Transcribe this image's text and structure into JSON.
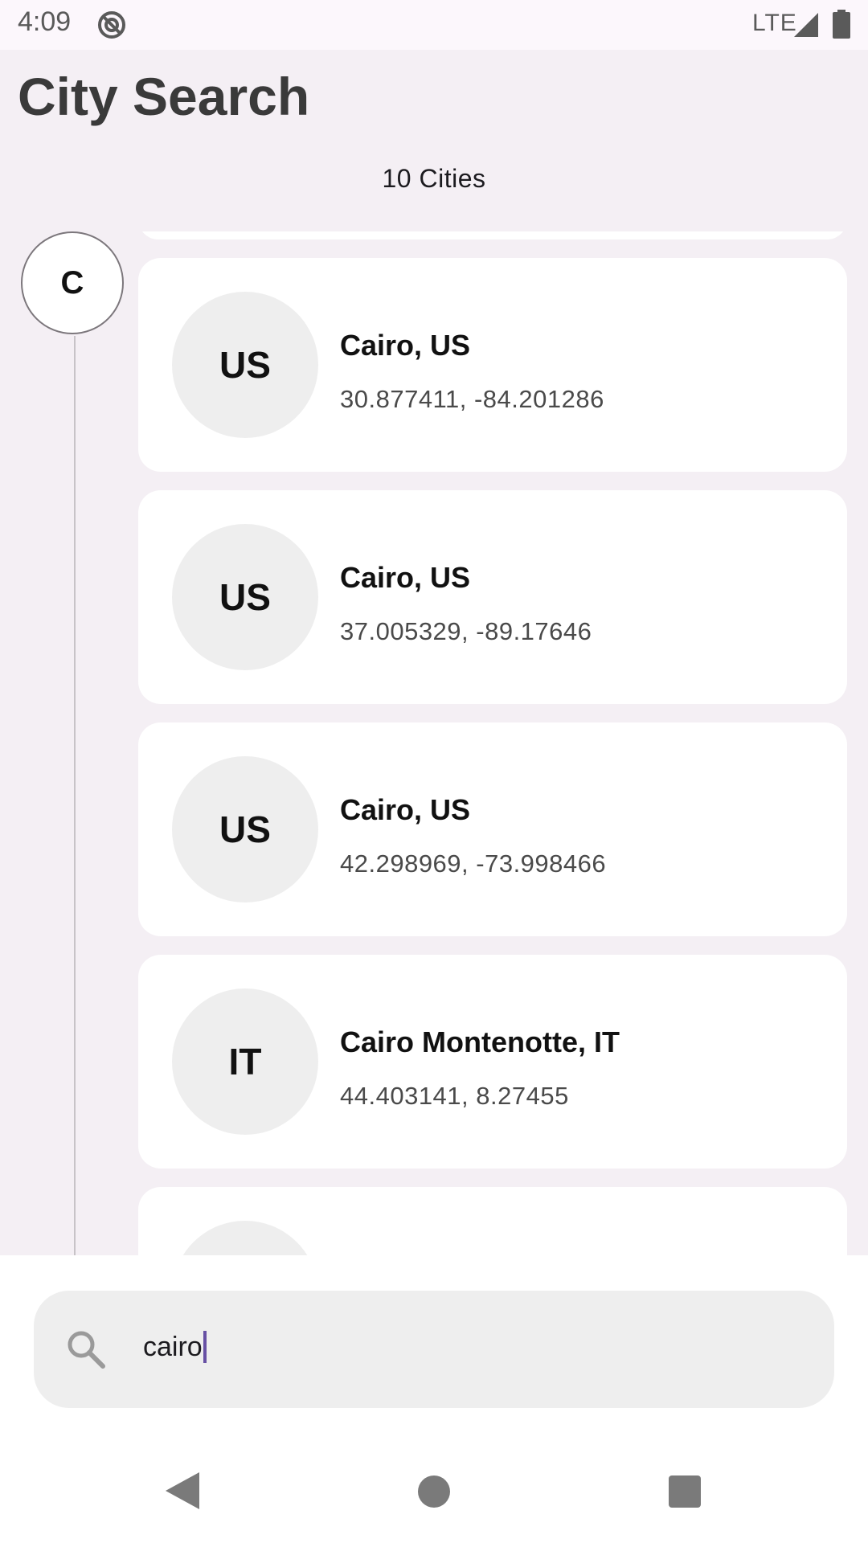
{
  "status_bar": {
    "time": "4:09",
    "network": "LTE",
    "icons": [
      "do-not-disturb-icon",
      "signal-icon",
      "battery-icon"
    ]
  },
  "header": {
    "title": "City Search",
    "count_label": "10 Cities"
  },
  "section": {
    "letter": "C"
  },
  "cities": [
    {
      "country": "US",
      "name": "Cairo, US",
      "coords": "30.877411, -84.201286"
    },
    {
      "country": "US",
      "name": "Cairo, US",
      "coords": "37.005329, -89.17646"
    },
    {
      "country": "US",
      "name": "Cairo, US",
      "coords": "42.298969, -73.998466"
    },
    {
      "country": "IT",
      "name": "Cairo Montenotte, IT",
      "coords": "44.403141, 8.27455"
    }
  ],
  "search": {
    "value": "cairo",
    "icon": "search-icon"
  },
  "nav_bar": {
    "icons": [
      "back-icon",
      "home-icon",
      "recents-icon"
    ]
  },
  "colors": {
    "background": "#f4eff4",
    "card": "#ffffff",
    "flag_circle": "#eeeeee",
    "caret": "#6750a4"
  }
}
